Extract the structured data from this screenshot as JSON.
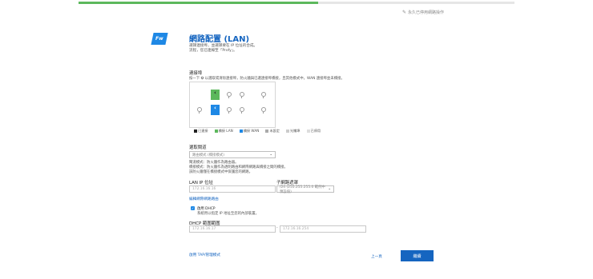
{
  "progress": {
    "percent": 55
  },
  "top_link": {
    "label": "永久已停用網路操作"
  },
  "logo": {
    "text": "Fw"
  },
  "header": {
    "title": "網路配置 (LAN)",
    "desc_line1": "選擇連接埠，並選擇要在 IP 位址的合成。",
    "desc_line2": "流程，您已連線至「Profy」。"
  },
  "ports_section": {
    "heading": "連接埠",
    "instruction": "按一下 ✪ 以選取或清除連接埠，防火牆與已選連接埠橋接，且其他模式中，WAN 連接埠並未橋接。",
    "legend": [
      {
        "label": "已連接",
        "color": "#222222"
      },
      {
        "label": "橋接 LAN",
        "color": "#5cb85c"
      },
      {
        "label": "橋接 WAN",
        "color": "#1e88e5"
      },
      {
        "label": "未設定",
        "color": "#aaaaaa"
      },
      {
        "label": "光纖埠",
        "color": "#cccccc"
      },
      {
        "label": "已停用",
        "color": "#dddddd"
      }
    ]
  },
  "mode_section": {
    "heading": "選取閘道",
    "select_value": "路由模式 (橋接模式)",
    "note1": "閘道模式：防火牆作為路由器。",
    "note2": "橋接模式：防火牆作為透明路由和網際網路與橋接之間的橋接。",
    "note3": "該防火牆僅在橋接模式中保護您的網路。"
  },
  "lan_ip": {
    "label": "LAN IP 位址",
    "placeholder": "172.16.16.16"
  },
  "subnet": {
    "label": "子網路遮罩",
    "value": "/24 (255.255.255.0 範例中預設值)"
  },
  "link_more": {
    "label": "編輯網際網路路由"
  },
  "dhcp": {
    "checkbox_label": "啟用 DHCP",
    "checkbox_desc": "系統用以指定 IP 地址至您的內部裝置。",
    "range_label": "DHCP 範圍範圍",
    "start_placeholder": "172.16.16.17",
    "end_placeholder": "172.16.16.254",
    "separator": "-"
  },
  "footer": {
    "tap_link": "啟用 TAP/管理模式",
    "back": "上一頁",
    "next": "繼續"
  },
  "colors": {
    "accent": "#1565c0",
    "green": "#5cb85c",
    "blue": "#1e88e5"
  }
}
